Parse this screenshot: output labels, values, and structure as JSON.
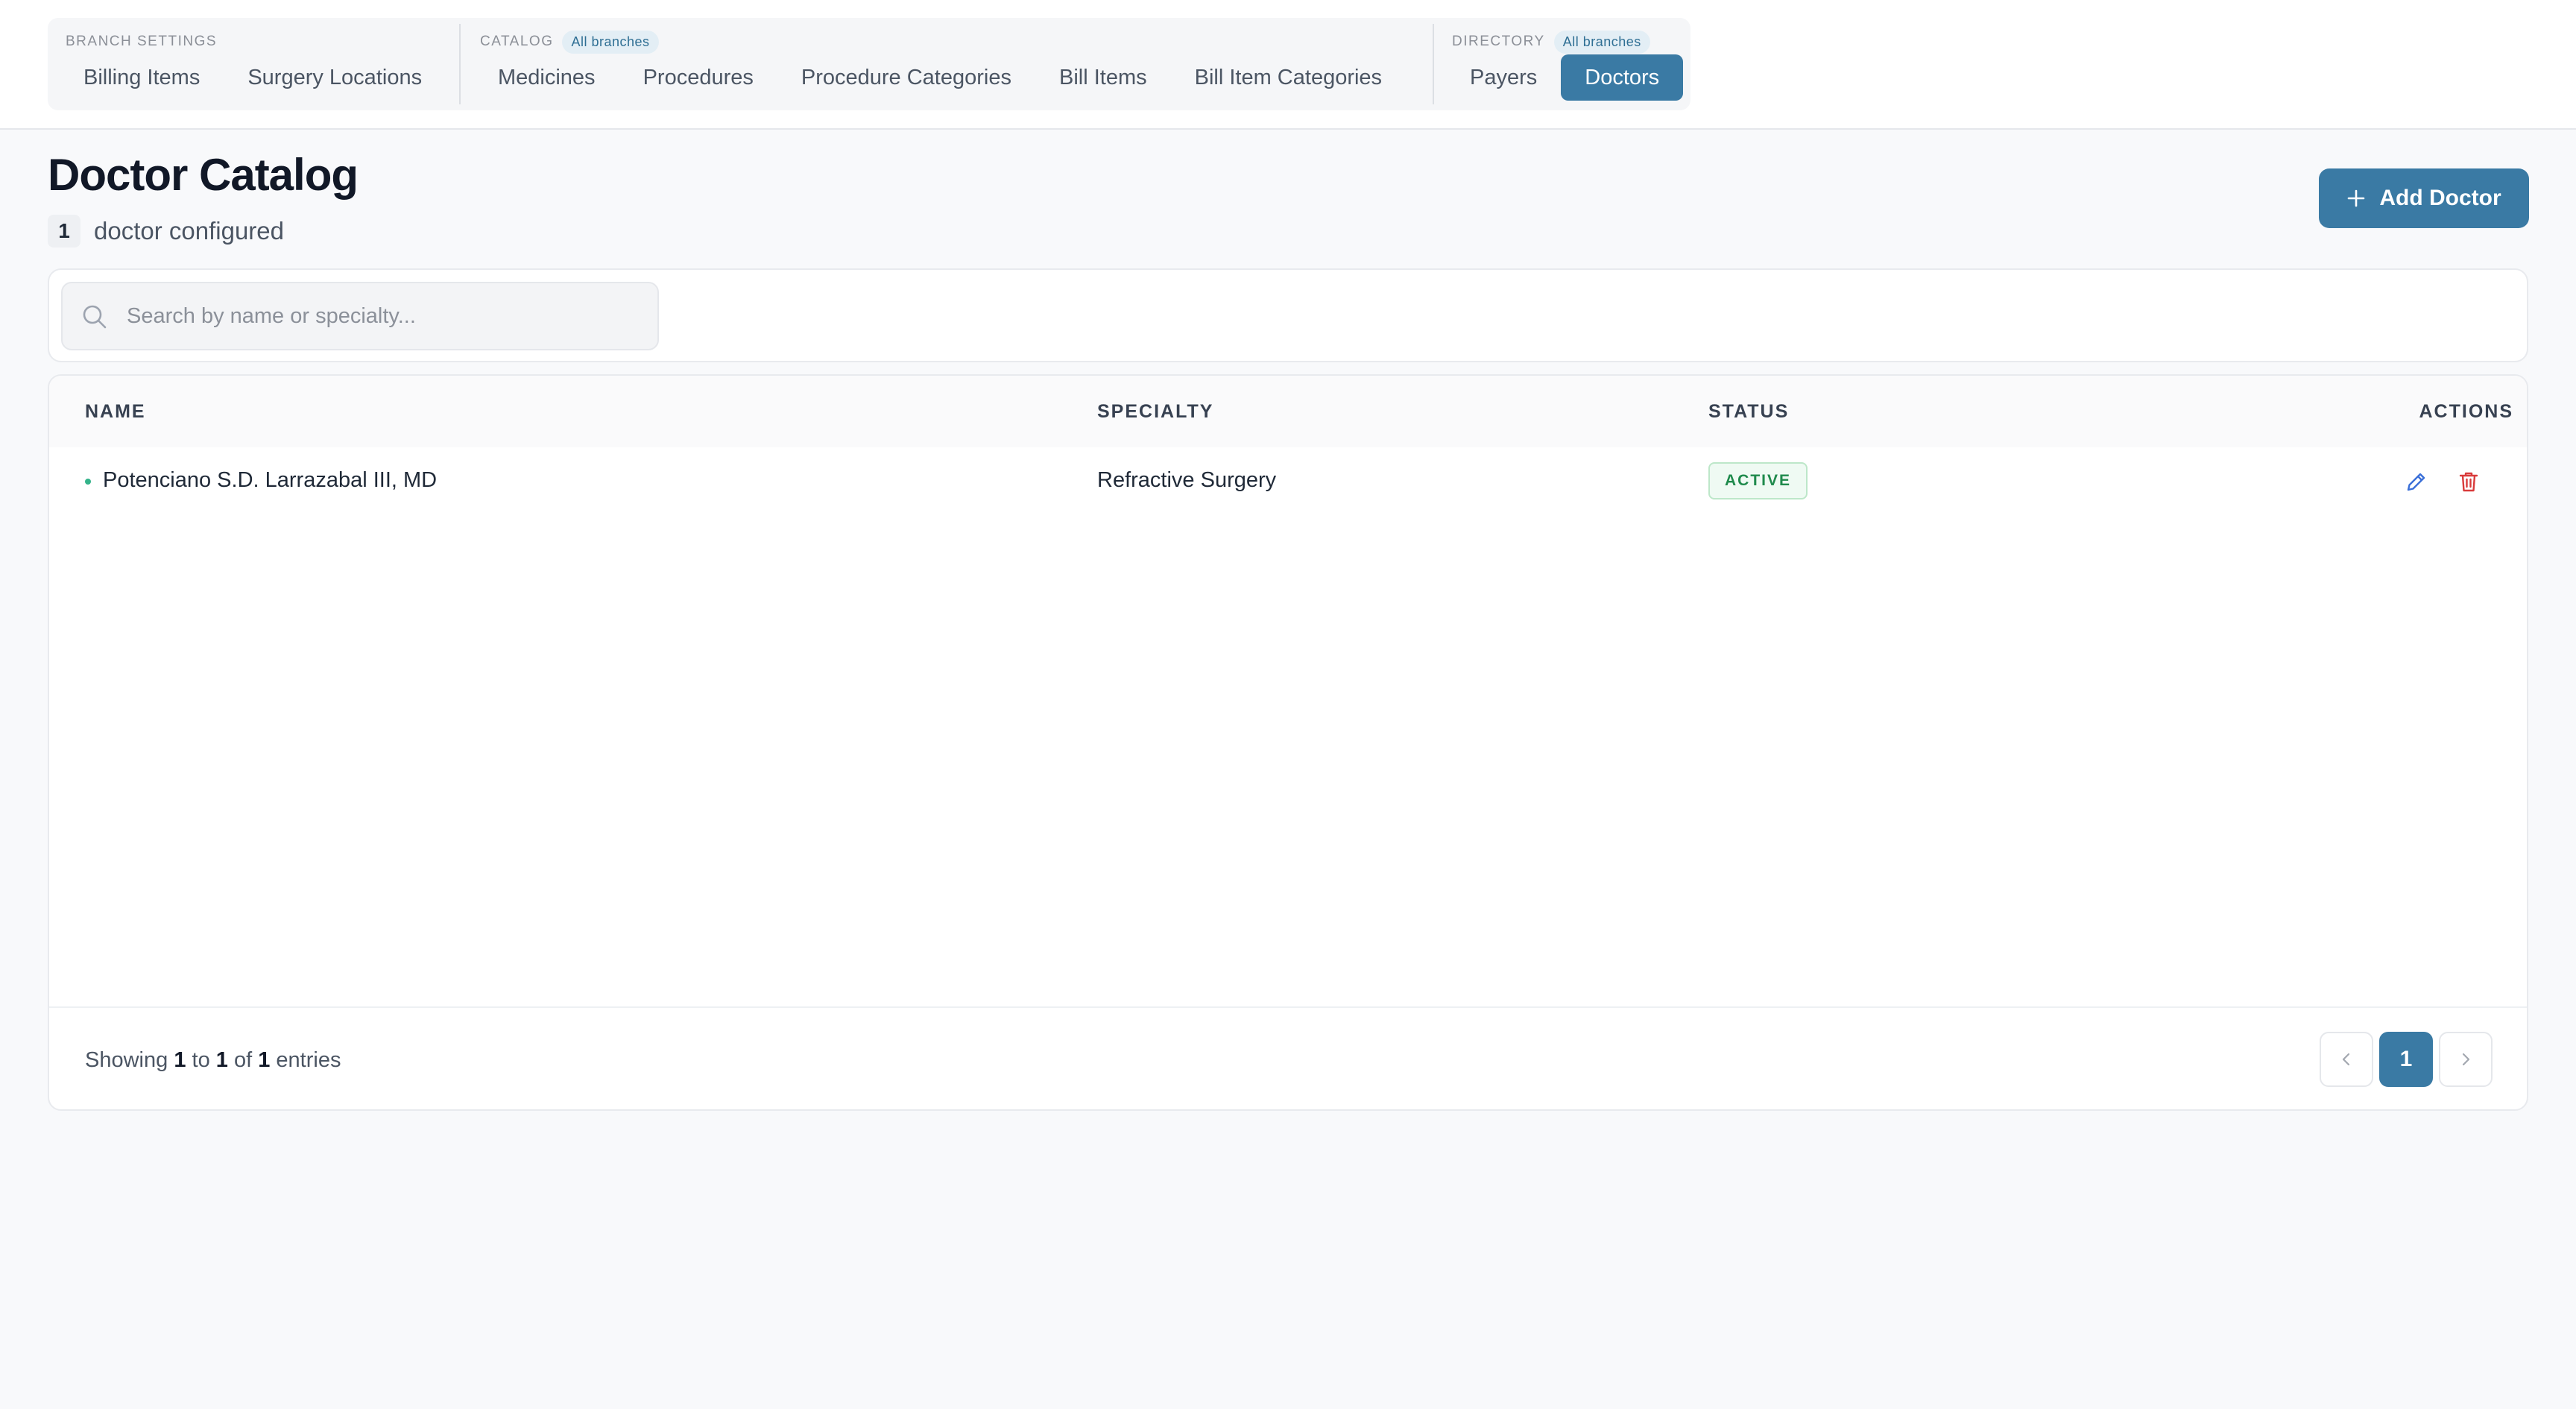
{
  "nav": {
    "groups": [
      {
        "heading": "BRANCH SETTINGS",
        "pill": null,
        "items": [
          "Billing Items",
          "Surgery Locations"
        ]
      },
      {
        "heading": "CATALOG",
        "pill": "All branches",
        "items": [
          "Medicines",
          "Procedures",
          "Procedure Categories",
          "Bill Items",
          "Bill Item Categories"
        ]
      },
      {
        "heading": "DIRECTORY",
        "pill": "All branches",
        "items": [
          "Payers",
          "Doctors"
        ]
      }
    ],
    "active_item": "Doctors"
  },
  "page": {
    "title": "Doctor Catalog",
    "count": "1",
    "count_label": "doctor configured",
    "add_button": "Add Doctor"
  },
  "search": {
    "placeholder": "Search by name or specialty..."
  },
  "table": {
    "columns": [
      "NAME",
      "SPECIALTY",
      "STATUS",
      "ACTIONS"
    ],
    "rows": [
      {
        "name": "Potenciano S.D. Larrazabal III, MD",
        "specialty": "Refractive Surgery",
        "status": "ACTIVE"
      }
    ]
  },
  "footer": {
    "showing_prefix": "Showing",
    "from": "1",
    "to_word": "to",
    "to": "1",
    "of_word": "of",
    "total": "1",
    "suffix": "entries",
    "current_page": "1"
  },
  "colors": {
    "accent": "#3a7aa4",
    "status_active": "#1f8a4c",
    "delete": "#d93b3b"
  },
  "icons": [
    "search-icon",
    "plus-icon",
    "edit-icon",
    "trash-icon",
    "chevron-left-icon",
    "chevron-right-icon"
  ]
}
